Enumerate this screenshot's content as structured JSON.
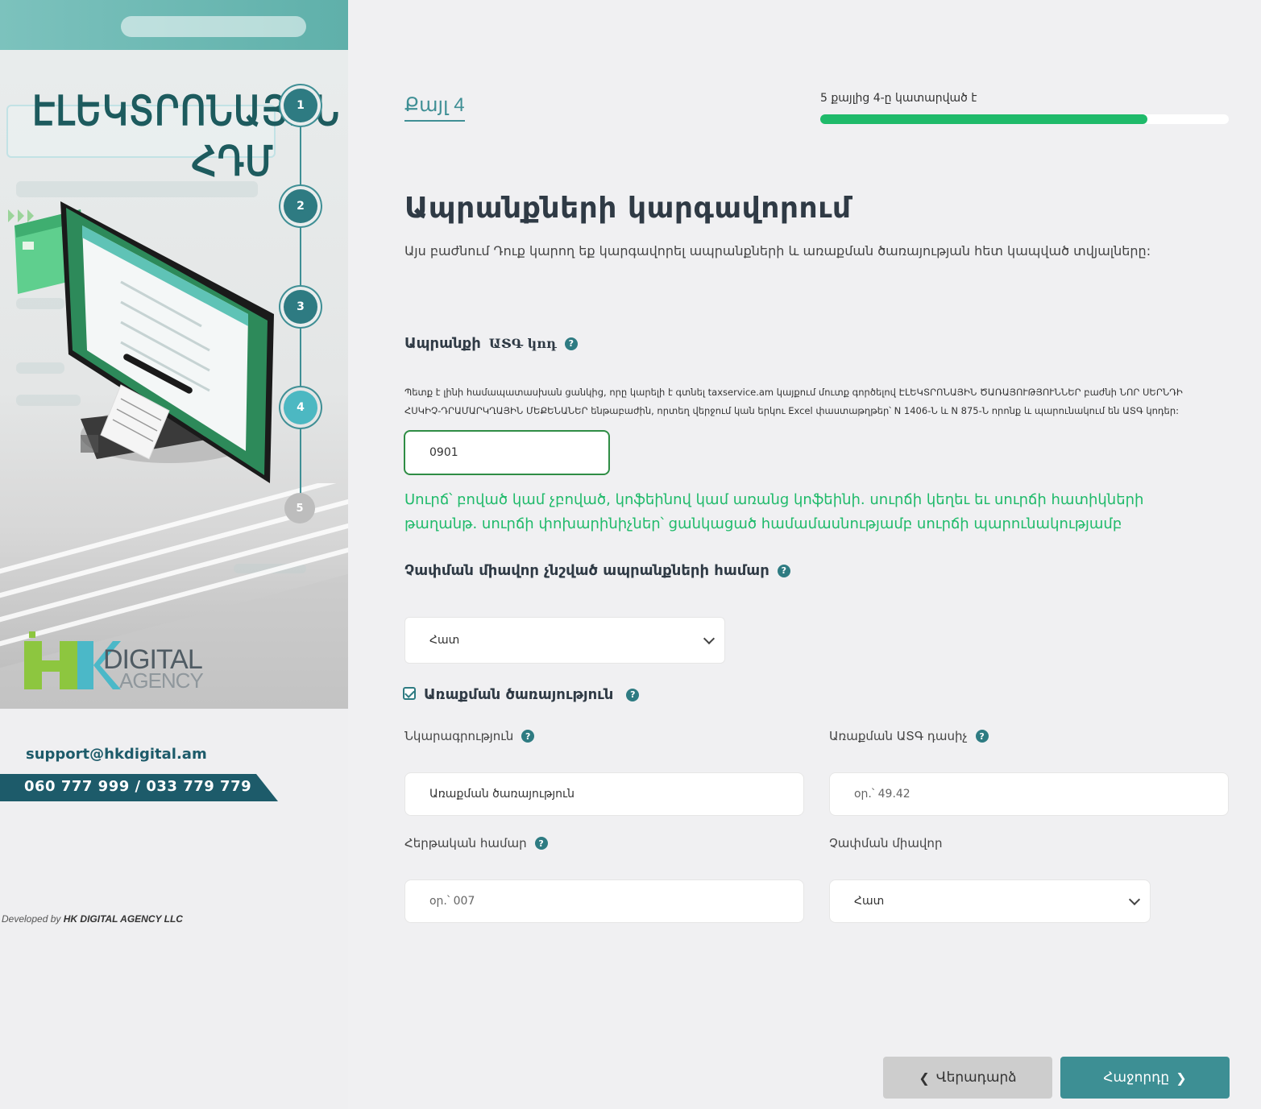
{
  "sidebar": {
    "hero_title_line1": "ԷԼԵԿՏՐՈՆԱՅԻՆ",
    "hero_title_line2": "ՀԴՄ",
    "steps": [
      "1",
      "2",
      "3",
      "4",
      "5"
    ],
    "current_step": 4,
    "logo_hk": "HK",
    "logo_digital": "DIGITAL",
    "logo_agency": "AGENCY",
    "support_email": "support@hkdigital.am",
    "phones": "060 777 999 / 033 779 779",
    "developed_by_prefix": "Developed by",
    "developed_by_company": "HK DIGITAL AGENCY LLC"
  },
  "header": {
    "step_label": "Քայլ 4",
    "progress_text": "5 քայլից 4-ը կատարված է",
    "progress_value": 0.8
  },
  "page": {
    "title": "Ապրանքների կարգավորում",
    "description": "Այս բաժնում Դուք կարող եք կարգավորել ապրանքների և առաքման ծառայության հետ կապված տվյալները:"
  },
  "form": {
    "atgcode_label_prefix": "Ապրանքի",
    "atgcode_label_code": "ԱՏԳ կոդ",
    "atgcode_hint": "Պետք է լինի համապատասխան ցանկից, որը կարելի է գտնել taxservice.am կայքում մուտք գործելով ԷԼԵԿՏՐՈՆԱՅԻՆ ԾԱՌԱՅՈՒԹՅՈՒՆՆԵՐ բաժնի ՆՈՐ ՍԵՐՆԴԻ ՀՍԿԻՉ-ԴՐԱՄԱՐԿՂԱՅԻՆ ՄԵՔԵՆԱՆԵՐ ենթաբաժին, որտեղ վերջում կան երկու Excel փաստաթղթեր՝ N 1406-Ն և N 875-Ն որոնք և պարունակում են ԱՏԳ կոդեր:",
    "atgcode_value": "0901",
    "atgcode_suggestion": "Սուրճ՝ բոված կամ չբոված, կոֆեինով կամ առանց կոֆեինի. սուրճի կեղեւ եւ սուրճի հատիկների թաղանթ. սուրճի փոխարինիչներ՝ ցանկացած համամասնությամբ սուրճի պարունակությամբ",
    "unit_label": "Չափման միավոր չնշված ապրանքների համար",
    "unit_value": "Հատ",
    "delivery_label": "Առաքման ծառայություն",
    "delivery_checked": true,
    "description_label": "Նկարագրություն",
    "description_value": "Առաքման ծառայություն",
    "delivery_atg_label": "Առաքման ԱՏԳ դասիչ",
    "delivery_atg_placeholder": "օր.՝ 49.42",
    "serial_label": "Հերթական համար",
    "serial_placeholder": "օր.՝ 007",
    "delivery_unit_label": "Չափման միավոր",
    "delivery_unit_value": "Հատ"
  },
  "buttons": {
    "back": "Վերադարձ",
    "next": "Հաջորդը"
  },
  "colors": {
    "accent": "#3d8f94",
    "progress": "#1fba6a",
    "suggestion": "#1fba6a",
    "dark_teal": "#1d5b6a"
  }
}
